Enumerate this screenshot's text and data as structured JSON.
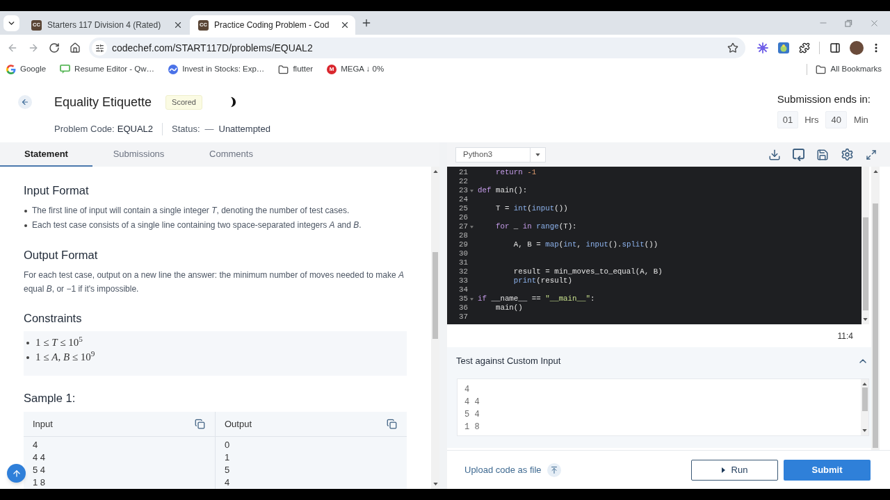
{
  "browser": {
    "tabs": [
      {
        "icon_text": "CC",
        "title": "Starters 117 Division 4 (Rated)",
        "selected": false
      },
      {
        "icon_text": "CC",
        "title": "Practice Coding Problem - Cod",
        "selected": true
      }
    ],
    "url": "codechef.com/START117D/problems/EQUAL2",
    "bookmarks": [
      {
        "label": "Google"
      },
      {
        "label": "Resume Editor - Qw…"
      },
      {
        "label": "Invest in Stocks: Exp…"
      },
      {
        "label": "flutter"
      },
      {
        "icon_text": "M",
        "label": "MEGA ↓ 0%"
      }
    ],
    "all_bookmarks": "All Bookmarks"
  },
  "problem": {
    "title": "Equality Etiquette",
    "badge": "Scored",
    "code_label": "Problem Code:",
    "code": "EQUAL2",
    "status_label": "Status:",
    "status_mark": "—",
    "status": "Unattempted"
  },
  "timer": {
    "label": "Submission ends in:",
    "hours": "01",
    "hours_unit": "Hrs",
    "minutes": "40",
    "minutes_unit": "Min"
  },
  "tabs": [
    {
      "label": "Statement",
      "selected": true
    },
    {
      "label": "Submissions",
      "selected": false
    },
    {
      "label": "Comments",
      "selected": false
    }
  ],
  "statement": [
    {
      "kind": "bullets",
      "heading": "Input Format",
      "items": [
        "The first line of input will contain a single integer *T*, denoting the number of test cases.",
        "Each test case consists of a single line containing two space-separated integers *A* and *B*."
      ]
    },
    {
      "kind": "paragraph",
      "heading": "Output Format",
      "text": "For each test case, output on a new line the answer: the minimum number of moves needed to make *A* equal *B*, or −1 if it's impossible."
    },
    {
      "kind": "math",
      "heading": "Constraints",
      "items": [
        "1 ≤ *T* ≤ 10$^{5}$",
        "1 ≤ *A*, *B* ≤ 10$^{9}$"
      ]
    },
    {
      "kind": "sample",
      "heading": "Sample 1:",
      "columns": [
        {
          "title": "Input",
          "value": "4\n4 4\n5 4\n1 8"
        },
        {
          "title": "Output",
          "value": "0\n1\n5\n4"
        }
      ]
    }
  ],
  "editor": {
    "language": "Python3",
    "lines": [
      {
        "number": "21",
        "foldable": false,
        "tokens": [
          {
            "kind": "keyword",
            "text": "    return"
          },
          {
            "kind": "number",
            "text": " -1"
          }
        ]
      },
      {
        "number": "22",
        "foldable": false
      },
      {
        "number": "23",
        "foldable": true,
        "tokens": [
          {
            "kind": "keyword",
            "text": "def"
          },
          {
            "kind": "plain",
            "text": " main():"
          }
        ]
      },
      {
        "number": "24",
        "foldable": false
      },
      {
        "number": "25",
        "foldable": false,
        "tokens": [
          {
            "kind": "plain",
            "text": "    T = "
          },
          {
            "kind": "builtin",
            "text": "int"
          },
          {
            "kind": "plain",
            "text": "("
          },
          {
            "kind": "builtin",
            "text": "input"
          },
          {
            "kind": "plain",
            "text": "())"
          }
        ]
      },
      {
        "number": "26",
        "foldable": false
      },
      {
        "number": "27",
        "foldable": true,
        "tokens": [
          {
            "kind": "keyword",
            "text": "    for"
          },
          {
            "kind": "plain",
            "text": " _ "
          },
          {
            "kind": "keyword",
            "text": "in"
          },
          {
            "kind": "builtin",
            "text": " range"
          },
          {
            "kind": "plain",
            "text": "(T):"
          }
        ]
      },
      {
        "number": "28",
        "foldable": false
      },
      {
        "number": "29",
        "foldable": false,
        "tokens": [
          {
            "kind": "plain",
            "text": "        A, B = "
          },
          {
            "kind": "builtin",
            "text": "map"
          },
          {
            "kind": "plain",
            "text": "("
          },
          {
            "kind": "builtin",
            "text": "int"
          },
          {
            "kind": "plain",
            "text": ", "
          },
          {
            "kind": "builtin",
            "text": "input"
          },
          {
            "kind": "plain",
            "text": "()."
          },
          {
            "kind": "builtin",
            "text": "split"
          },
          {
            "kind": "plain",
            "text": "())"
          }
        ]
      },
      {
        "number": "30",
        "foldable": false
      },
      {
        "number": "31",
        "foldable": false
      },
      {
        "number": "32",
        "foldable": false,
        "tokens": [
          {
            "kind": "plain",
            "text": "        result = min_moves_to_equal(A, B)"
          }
        ]
      },
      {
        "number": "33",
        "foldable": false,
        "tokens": [
          {
            "kind": "builtin",
            "text": "        print"
          },
          {
            "kind": "plain",
            "text": "(result)"
          }
        ]
      },
      {
        "number": "34",
        "foldable": false
      },
      {
        "number": "35",
        "foldable": true,
        "tokens": [
          {
            "kind": "keyword",
            "text": "if"
          },
          {
            "kind": "plain",
            "text": " __name__ == "
          },
          {
            "kind": "string",
            "text": "\"__main__\""
          },
          {
            "kind": "plain",
            "text": ":"
          }
        ]
      },
      {
        "number": "36",
        "foldable": false,
        "tokens": [
          {
            "kind": "plain",
            "text": "    main()"
          }
        ]
      },
      {
        "number": "37",
        "foldable": false
      }
    ],
    "cursor": "11:4"
  },
  "custom_input": {
    "title": "Test against Custom Input",
    "expanded": true,
    "value": "4\n4 4\n5 4\n1 8"
  },
  "footer": {
    "upload": "Upload code as file",
    "run": "Run",
    "submit": "Submit"
  }
}
